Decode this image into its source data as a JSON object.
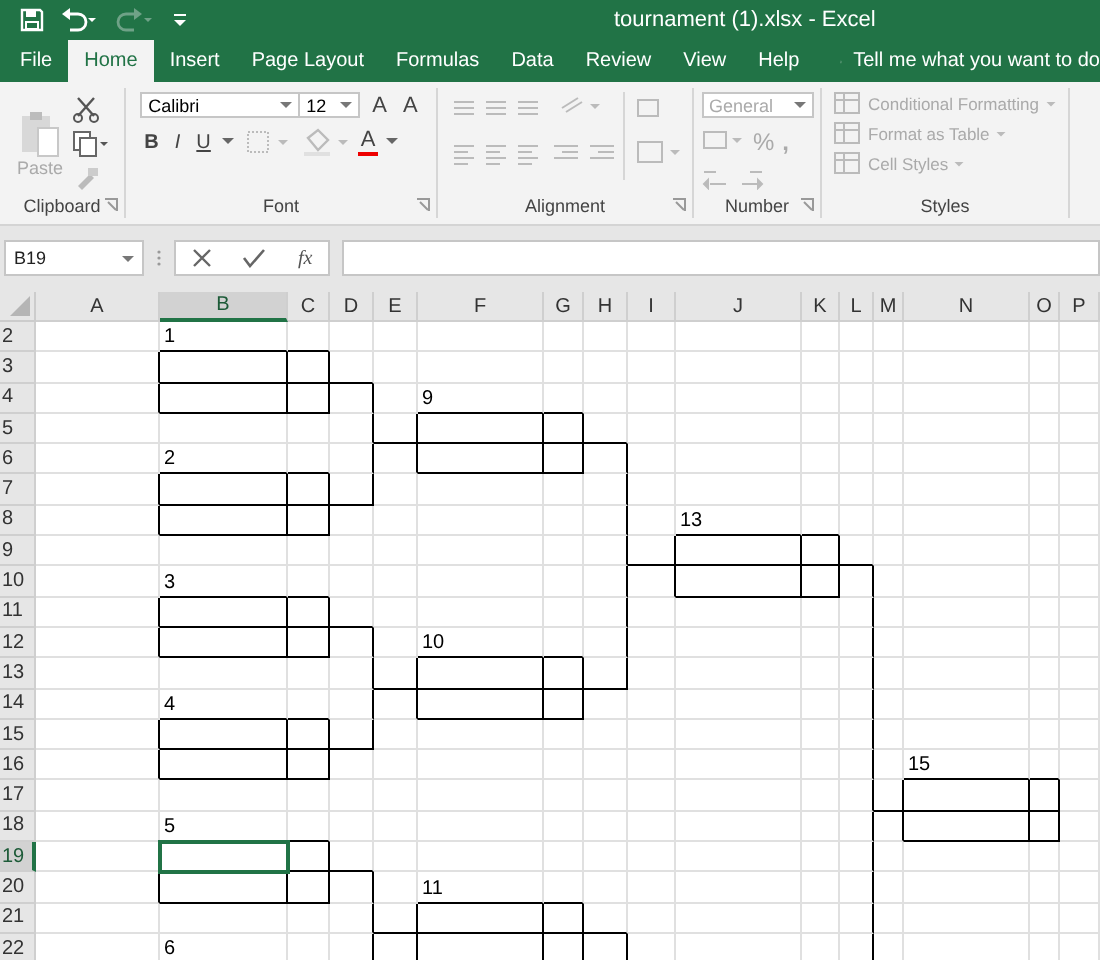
{
  "window": {
    "title": "tournament (1).xlsx  -  Excel"
  },
  "tabs": [
    {
      "label": "File",
      "selected": false
    },
    {
      "label": "Home",
      "selected": true
    },
    {
      "label": "Insert",
      "selected": false
    },
    {
      "label": "Page Layout",
      "selected": false
    },
    {
      "label": "Formulas",
      "selected": false
    },
    {
      "label": "Data",
      "selected": false
    },
    {
      "label": "Review",
      "selected": false
    },
    {
      "label": "View",
      "selected": false
    },
    {
      "label": "Help",
      "selected": false
    }
  ],
  "tell_me": "Tell me what you want to do",
  "ribbon": {
    "clipboard": {
      "paste": "Paste",
      "label": "Clipboard"
    },
    "font": {
      "name": "Calibri",
      "size": "12",
      "grow": "A",
      "shrink": "A",
      "bold": "B",
      "italic": "I",
      "underline": "U",
      "color_button": "A",
      "label": "Font"
    },
    "alignment": {
      "label": "Alignment"
    },
    "number": {
      "format": "General",
      "percent": "%",
      "comma": ",",
      "label": "Number"
    },
    "styles": {
      "items": [
        "Conditional Formatting",
        "Format as Table",
        "Cell Styles"
      ],
      "label": "Styles"
    }
  },
  "formula_bar": {
    "name_box": "B19",
    "fx": "fx"
  },
  "sheet": {
    "columns": [
      {
        "label": "A",
        "selected": false
      },
      {
        "label": "B",
        "selected": true
      },
      {
        "label": "C",
        "selected": false
      },
      {
        "label": "D",
        "selected": false
      },
      {
        "label": "E",
        "selected": false
      },
      {
        "label": "F",
        "selected": false
      },
      {
        "label": "G",
        "selected": false
      },
      {
        "label": "H",
        "selected": false
      },
      {
        "label": "I",
        "selected": false
      },
      {
        "label": "J",
        "selected": false
      },
      {
        "label": "K",
        "selected": false
      },
      {
        "label": "L",
        "selected": false
      },
      {
        "label": "M",
        "selected": false
      },
      {
        "label": "N",
        "selected": false
      },
      {
        "label": "O",
        "selected": false
      },
      {
        "label": "P",
        "selected": false
      }
    ],
    "rows": [
      {
        "label": "2",
        "selected": false
      },
      {
        "label": "3",
        "selected": false
      },
      {
        "label": "4",
        "selected": false
      },
      {
        "label": "5",
        "selected": false
      },
      {
        "label": "6",
        "selected": false
      },
      {
        "label": "7",
        "selected": false
      },
      {
        "label": "8",
        "selected": false
      },
      {
        "label": "9",
        "selected": false
      },
      {
        "label": "10",
        "selected": false
      },
      {
        "label": "11",
        "selected": false
      },
      {
        "label": "12",
        "selected": false
      },
      {
        "label": "13",
        "selected": false
      },
      {
        "label": "14",
        "selected": false
      },
      {
        "label": "15",
        "selected": false
      },
      {
        "label": "16",
        "selected": false
      },
      {
        "label": "17",
        "selected": false
      },
      {
        "label": "18",
        "selected": false
      },
      {
        "label": "19",
        "selected": true
      },
      {
        "label": "20",
        "selected": false
      },
      {
        "label": "21",
        "selected": false
      },
      {
        "label": "22",
        "selected": false
      }
    ],
    "bracket": [
      [
        {
          "label": "1"
        },
        {
          "label": "2"
        },
        {
          "label": "3"
        },
        {
          "label": "4"
        },
        {
          "label": "5"
        },
        {
          "label": "6"
        }
      ],
      [
        {
          "label": "9"
        },
        {
          "label": "10"
        },
        {
          "label": "11"
        }
      ],
      [
        {
          "label": "13"
        }
      ],
      [
        {
          "label": "15"
        }
      ]
    ]
  }
}
